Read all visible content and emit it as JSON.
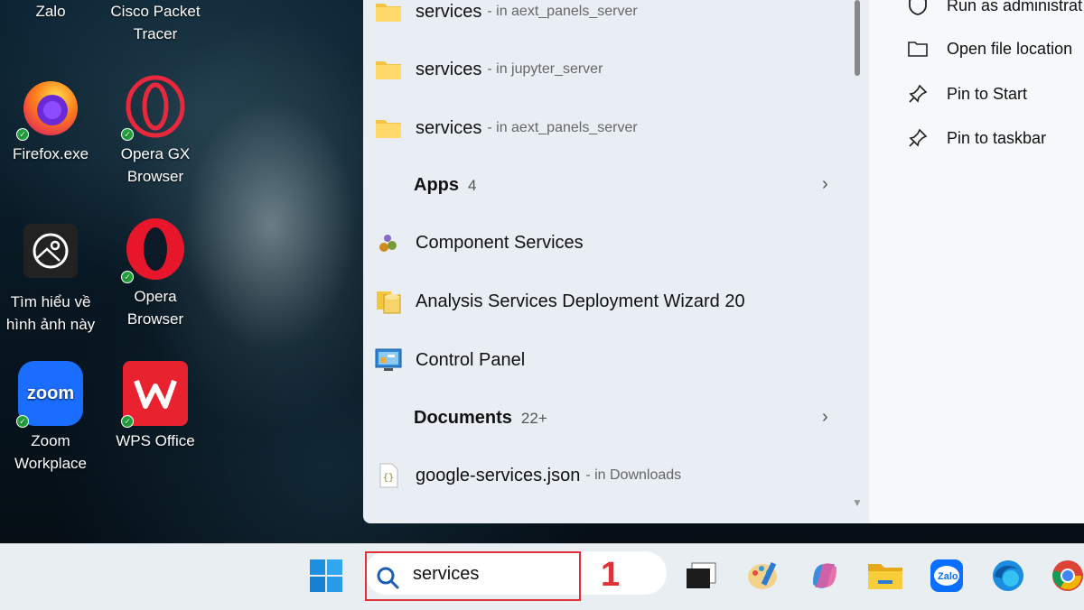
{
  "desktop": {
    "icons": [
      {
        "label_lines": [
          "Zalo"
        ]
      },
      {
        "label_lines": [
          "Cisco Packet",
          "Tracer"
        ]
      },
      {
        "label_lines": [
          "Firefox.exe"
        ]
      },
      {
        "label_lines": [
          "Opera GX",
          "Browser"
        ]
      },
      {
        "label_lines": [
          "Tìm hiểu về",
          "hình ảnh này"
        ]
      },
      {
        "label_lines": [
          "Opera",
          "Browser"
        ]
      },
      {
        "label_lines": [
          "Zoom",
          "Workplace"
        ]
      },
      {
        "label_lines": [
          "WPS Office"
        ]
      }
    ],
    "zoom_logo_text": "zoom"
  },
  "search_results": {
    "folders": [
      {
        "name": "services",
        "location": "- in aext_panels_server"
      },
      {
        "name": "services",
        "location": "- in jupyter_server"
      },
      {
        "name": "services",
        "location": "- in aext_panels_server"
      }
    ],
    "apps_section": {
      "title": "Apps",
      "count": "4"
    },
    "apps": [
      {
        "name": "Component Services",
        "icon": "component-services-icon"
      },
      {
        "name": "Analysis Services Deployment Wizard 20",
        "icon": "analysis-services-icon"
      },
      {
        "name": "Control Panel",
        "icon": "control-panel-icon"
      }
    ],
    "documents_section": {
      "title": "Documents",
      "count": "22+"
    },
    "documents": [
      {
        "name": "google-services.json",
        "location": "- in Downloads"
      }
    ]
  },
  "context_menu": {
    "items": [
      {
        "label": "Run as administrat",
        "icon": "shield-icon"
      },
      {
        "label": "Open file location",
        "icon": "folder-icon"
      },
      {
        "label": "Pin to Start",
        "icon": "pin-icon"
      },
      {
        "label": "Pin to taskbar",
        "icon": "pin-icon"
      }
    ]
  },
  "taskbar": {
    "search_value": "services",
    "step_label": "1",
    "highlight_color": "#e03138"
  }
}
